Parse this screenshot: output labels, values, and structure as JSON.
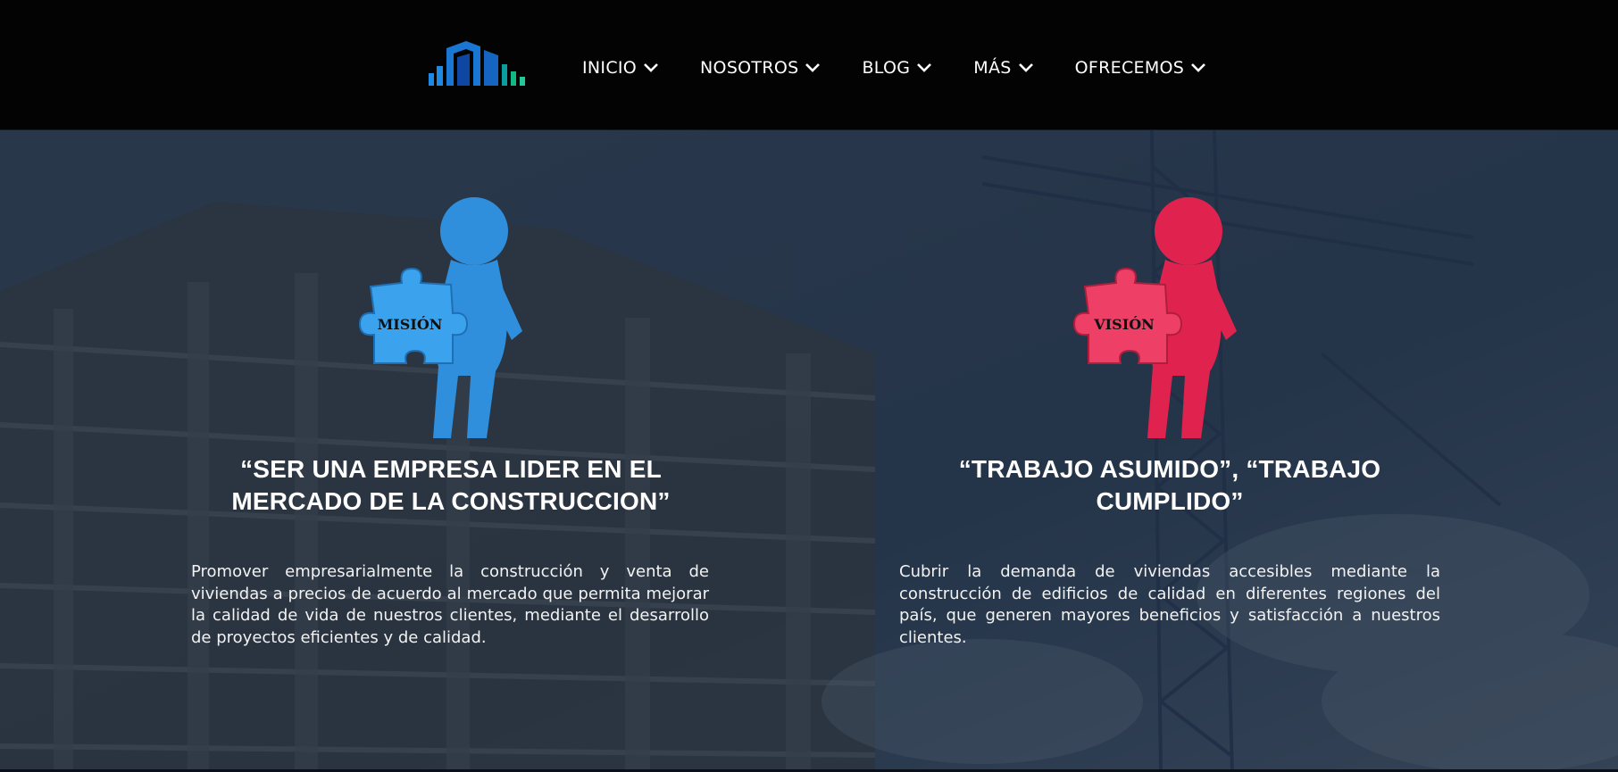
{
  "nav": {
    "items": [
      {
        "label": "INICIO"
      },
      {
        "label": "NOSOTROS"
      },
      {
        "label": "BLOG"
      },
      {
        "label": "MÁS"
      },
      {
        "label": "OFRECEMOS"
      }
    ]
  },
  "mission": {
    "puzzle_label": "MISIÓN",
    "heading": "“SER UNA EMPRESA LIDER EN EL MERCADO DE LA CONSTRUCCION”",
    "text": "Promover empresarialmente la construcción y venta de viviendas a precios de acuerdo al mercado que permita mejorar la calidad de vida de nuestros clientes, mediante el desarrollo de proyectos eficientes y de calidad.",
    "color": "#2f8fdc"
  },
  "vision": {
    "puzzle_label": "VISIÓN",
    "heading": "“TRABAJO ASUMIDO”, “TRABAJO CUMPLIDO”",
    "text": "Cubrir la demanda de viviendas accesibles mediante la construcción de edificios de calidad en diferentes regiones del país, que generen mayores beneficios y satisfacción a nuestros clientes.",
    "color": "#e0234e"
  }
}
